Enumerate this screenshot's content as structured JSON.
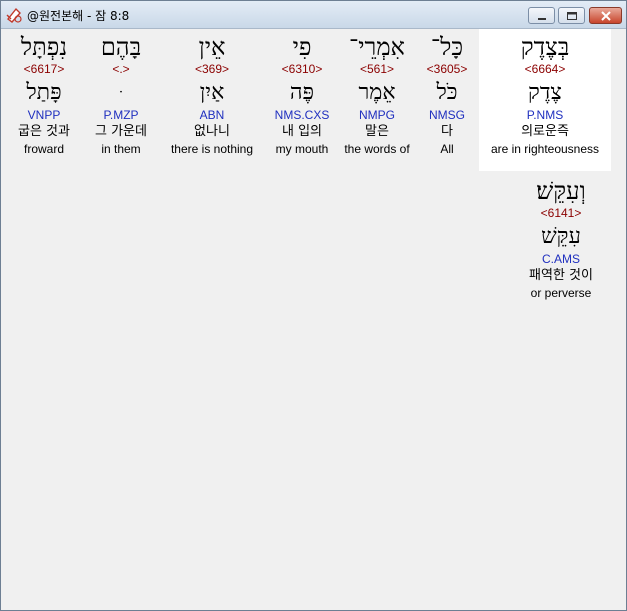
{
  "window": {
    "title": "@원전본해 - 잠 8:8"
  },
  "words": [
    {
      "hebrew": "בְּצֶדֶק",
      "strong": "<6664>",
      "lemma": "צֶדֶק",
      "morph": "P.NMS",
      "korean": "의로운즉",
      "english": "are in righteousness"
    },
    {
      "hebrew": "כָּל־",
      "strong": "<3605>",
      "lemma": "כֹּל",
      "morph": "NMSG",
      "korean": "다",
      "english": "All"
    },
    {
      "hebrew": "אִמְרֵי־",
      "strong": "<561>",
      "lemma": "אֵמֶר",
      "morph": "NMPG",
      "korean": "말은",
      "english": "the words of"
    },
    {
      "hebrew": "פִי",
      "strong": "<6310>",
      "lemma": "פֶּה",
      "morph": "NMS.CXS",
      "korean": "내 입의",
      "english": "my mouth"
    },
    {
      "hebrew": "אֵין",
      "strong": "<369>",
      "lemma": "אַיִן",
      "morph": "ABN",
      "korean": "없나니",
      "english": "there is nothing"
    },
    {
      "hebrew": "בָּהֶם",
      "strong": "<.>",
      "lemma": "ּ",
      "morph": "P.MZP",
      "korean": "그 가운데",
      "english": "in them"
    },
    {
      "hebrew": "נִפְתָּל",
      "strong": "<6617>",
      "lemma": "פָּתַל",
      "morph": "VNPP",
      "korean": "굽은 것과",
      "english": "froward"
    },
    {
      "hebrew": "וְעִקֵּשׁ׃",
      "strong": "<6141>",
      "lemma": "עִקֵּשׁ",
      "morph": "C.AMS",
      "korean": "패역한 것이",
      "english": "or perverse"
    }
  ]
}
